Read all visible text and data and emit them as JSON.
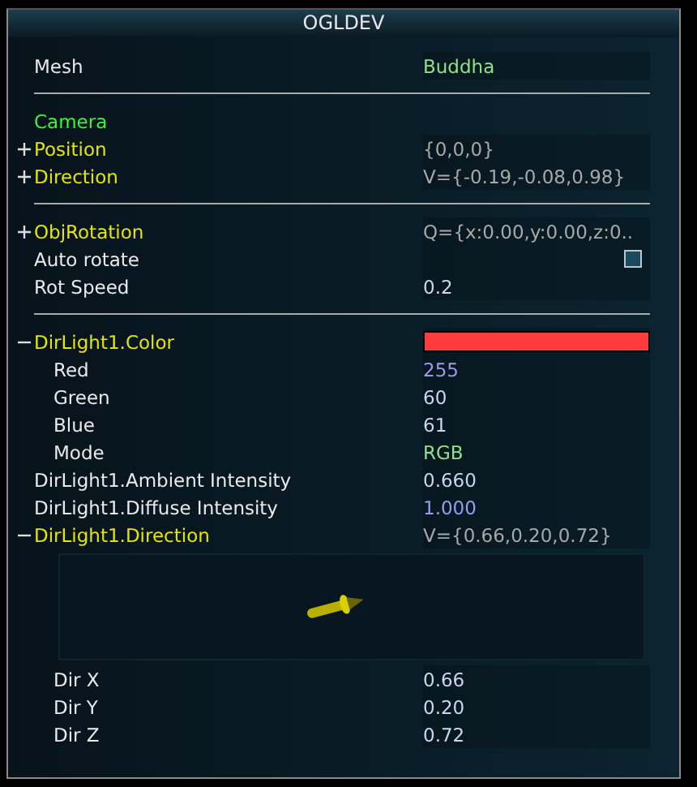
{
  "window": {
    "title": "OGLDEV"
  },
  "rows": [
    {
      "kind": "value",
      "label": "Mesh",
      "value": {
        "kind": "enum",
        "text": "Buddha"
      }
    },
    {
      "kind": "separator"
    },
    {
      "kind": "heading",
      "label": "Camera"
    },
    {
      "kind": "group",
      "label": "Position",
      "expanded": false,
      "value": {
        "kind": "readonly",
        "text": "{0,0,0}"
      }
    },
    {
      "kind": "group",
      "label": "Direction",
      "expanded": false,
      "value": {
        "kind": "readonly",
        "text": "V={-0.19,-0.08,0.98}"
      }
    },
    {
      "kind": "separator"
    },
    {
      "kind": "group",
      "label": "ObjRotation",
      "expanded": false,
      "value": {
        "kind": "readonly",
        "text": "Q={x:0.00,y:0.00,z:0.."
      }
    },
    {
      "kind": "checkbox",
      "label": "Auto rotate",
      "checked": false
    },
    {
      "kind": "value",
      "label": "Rot Speed",
      "value": {
        "kind": "number",
        "text": "0.2"
      }
    },
    {
      "kind": "separator"
    },
    {
      "kind": "color-group",
      "label": "DirLight1.Color",
      "expanded": true,
      "color": "#ff3c3d",
      "children": [
        {
          "kind": "value",
          "label": "Red",
          "value": {
            "kind": "focus",
            "text": "255"
          }
        },
        {
          "kind": "value",
          "label": "Green",
          "value": {
            "kind": "number",
            "text": "60"
          }
        },
        {
          "kind": "value",
          "label": "Blue",
          "value": {
            "kind": "number",
            "text": "61"
          }
        },
        {
          "kind": "value",
          "label": "Mode",
          "value": {
            "kind": "enum",
            "text": "RGB"
          }
        }
      ]
    },
    {
      "kind": "value",
      "label": "DirLight1.Ambient Intensity",
      "value": {
        "kind": "number",
        "text": "0.660"
      }
    },
    {
      "kind": "value",
      "label": "DirLight1.Diffuse Intensity",
      "value": {
        "kind": "focus",
        "text": "1.000"
      }
    },
    {
      "kind": "group",
      "label": "DirLight1.Direction",
      "expanded": true,
      "value": {
        "kind": "readonly",
        "text": "V={0.66,0.20,0.72}"
      },
      "children": [
        {
          "kind": "direction-widget"
        },
        {
          "kind": "value",
          "label": "Dir X",
          "value": {
            "kind": "number",
            "text": "0.66"
          }
        },
        {
          "kind": "value",
          "label": "Dir Y",
          "value": {
            "kind": "number",
            "text": "0.20"
          }
        },
        {
          "kind": "value",
          "label": "Dir Z",
          "value": {
            "kind": "number",
            "text": "0.72"
          }
        }
      ]
    }
  ]
}
